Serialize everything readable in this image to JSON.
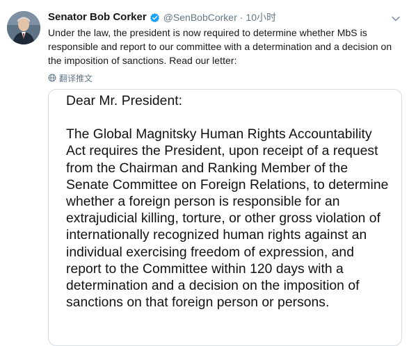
{
  "tweet": {
    "display_name": "Senator Bob Corker",
    "handle": "@SenBobCorker",
    "separator": "·",
    "time": "10小时",
    "text": "Under the law, the president is now required to determine whether MbS is responsible and report to our committee with a determination and a decision on the imposition of sanctions. Read our letter:",
    "translate_label": "翻译推文",
    "icons": {
      "verified": "verified-badge-icon",
      "menu": "chevron-down-icon",
      "translate": "globe-icon"
    },
    "colors": {
      "verified_blue": "#1da1f2",
      "secondary_text": "#657786",
      "primary_text": "#14171a"
    }
  },
  "letter": {
    "salutation": "Dear Mr. President:",
    "body": "The Global Magnitsky Human Rights Accountability Act requires the President, upon receipt of a request from the Chairman and Ranking Member of the Senate Committee on Foreign Relations, to determine whether a foreign person is responsible for an extrajudicial killing, torture, or other gross violation of internationally recognized human rights against an individual exercising freedom of expression, and report to the Committee within 120 days with a determination and a decision on the imposition of sanctions on that foreign person or persons."
  }
}
